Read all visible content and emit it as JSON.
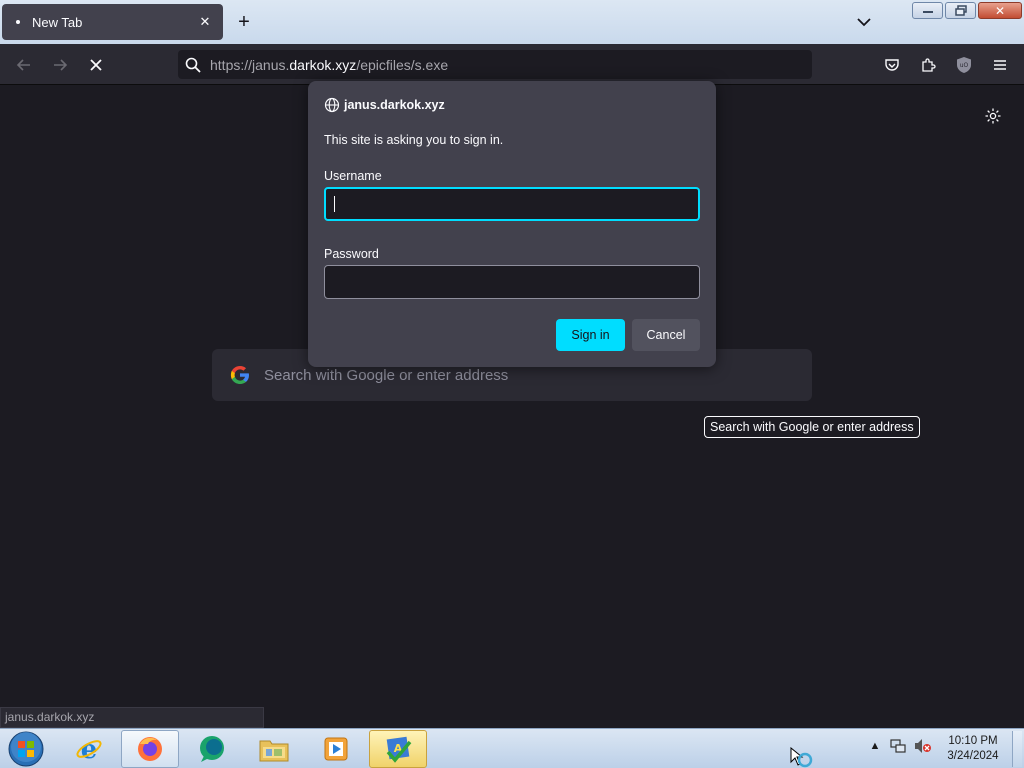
{
  "tab": {
    "title": "New Tab",
    "new_tab_label": "+"
  },
  "window_controls": {
    "minimize": "minimize",
    "restore": "restore",
    "close": "close"
  },
  "toolbar": {
    "url_prefix": "https://janus.",
    "url_domain": "darkok.xyz",
    "url_path": "/epicfiles/s.exe"
  },
  "dialog": {
    "host": "janus.darkok.xyz",
    "message": "This site is asking you to sign in.",
    "username_label": "Username",
    "username_value": "",
    "password_label": "Password",
    "password_value": "",
    "sign_in_label": "Sign in",
    "cancel_label": "Cancel"
  },
  "newtab_page": {
    "search_placeholder": "Search with Google or enter address"
  },
  "tooltip": {
    "text": "Search with Google or enter address"
  },
  "status": {
    "text": "janus.darkok.xyz"
  },
  "taskbar": {
    "apps": [
      "internet-explorer",
      "firefox",
      "chat",
      "file-explorer",
      "media-player",
      "system-app"
    ],
    "clock_time": "10:10 PM",
    "clock_date": "3/24/2024"
  },
  "colors": {
    "accent": "#00ddff",
    "panel": "#42414d",
    "background": "#1c1b22",
    "toolbar": "#2b2a33"
  }
}
